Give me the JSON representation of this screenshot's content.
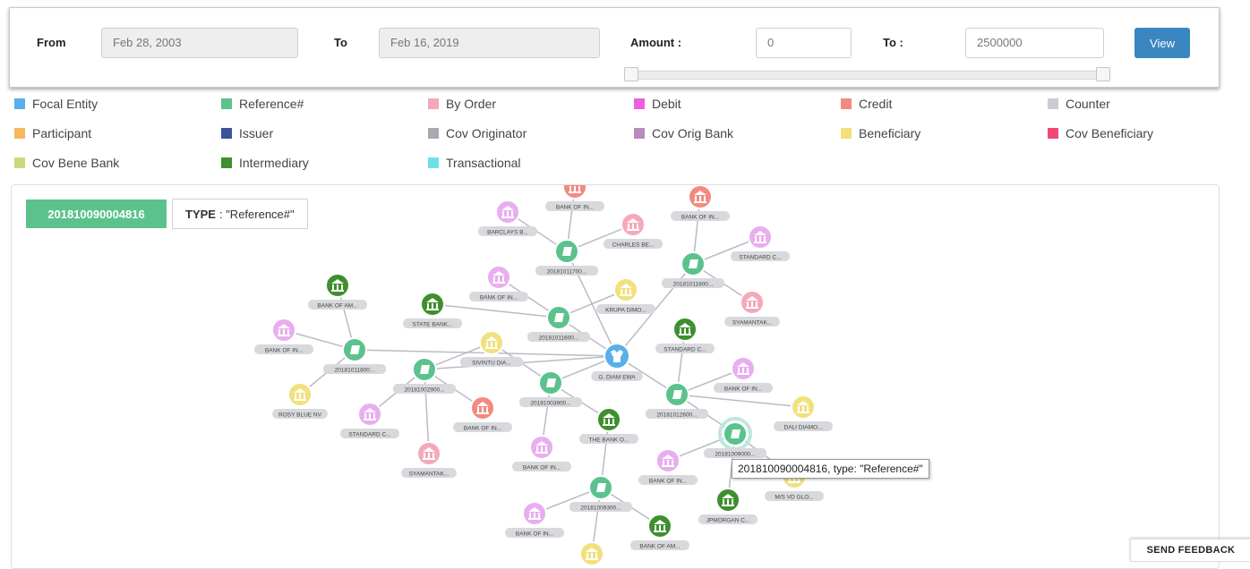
{
  "filters": {
    "from_label": "From",
    "from_value": "Feb 28, 2003",
    "to_label": "To",
    "to_value": "Feb 16, 2019",
    "amount_label": "Amount :",
    "amount_min": "0",
    "amount_to_label": "To :",
    "amount_max": "2500000",
    "view_label": "View",
    "slider_range": [
      0,
      1
    ]
  },
  "legend": [
    {
      "label": "Focal Entity",
      "color": "#5aafea"
    },
    {
      "label": "Reference#",
      "color": "#5cc28d"
    },
    {
      "label": "By Order",
      "color": "#f4a9bb"
    },
    {
      "label": "Debit",
      "color": "#ee5ee0"
    },
    {
      "label": "Credit",
      "color": "#f38a80"
    },
    {
      "label": "Counter",
      "color": "#c9ccd3"
    },
    {
      "label": "Participant",
      "color": "#f4b95c"
    },
    {
      "label": "Issuer",
      "color": "#3a5399"
    },
    {
      "label": "Cov Originator",
      "color": "#a7aab0"
    },
    {
      "label": "Cov Orig Bank",
      "color": "#b98bbf"
    },
    {
      "label": "Beneficiary",
      "color": "#f2e07c"
    },
    {
      "label": "Cov Beneficiary",
      "color": "#ee4a74"
    },
    {
      "label": "Cov Bene Bank",
      "color": "#c8da7a"
    },
    {
      "label": "Intermediary",
      "color": "#3e8f2e"
    },
    {
      "label": "Transactional",
      "color": "#6ee0e8"
    }
  ],
  "selected": {
    "id": "201810090004816",
    "type_label": "TYPE",
    "type_value": ": \"Reference#\""
  },
  "tooltip": "201810090004816, type: \"Reference#\"",
  "feedback_label": "SEND FEEDBACK",
  "graph": {
    "node_colors": {
      "ref": "#5cc28d",
      "bank_pink": "#e8aef0",
      "bank_green": "#3e8f2e",
      "bank_red": "#f38a80",
      "bank_rose": "#f4a9bb",
      "bene": "#f2e07c",
      "focal": "#5aafea"
    },
    "nodes": [
      {
        "id": "focal",
        "kind": "focal",
        "label": "G. DIAM EWA"
      },
      {
        "id": "r1",
        "kind": "ref",
        "label": "20181011700..."
      },
      {
        "id": "r2",
        "kind": "ref",
        "label": "20181011800..."
      },
      {
        "id": "r3",
        "kind": "ref",
        "label": "20181011600..."
      },
      {
        "id": "r4",
        "kind": "ref",
        "label": "20181011800..."
      },
      {
        "id": "r5",
        "kind": "ref",
        "label": "20181002900..."
      },
      {
        "id": "r6",
        "kind": "ref",
        "label": "20181003900..."
      },
      {
        "id": "r7",
        "kind": "ref",
        "label": "20181012600..."
      },
      {
        "id": "r8",
        "kind": "ref",
        "label": "20181009000..."
      },
      {
        "id": "r9",
        "kind": "ref",
        "label": "20181009300..."
      },
      {
        "id": "b1",
        "kind": "bank_red",
        "label": "BANK OF IN..."
      },
      {
        "id": "b2",
        "kind": "bank_pink",
        "label": "BARCLAYS B..."
      },
      {
        "id": "b3",
        "kind": "bank_rose",
        "label": "CHARLES BE..."
      },
      {
        "id": "b4",
        "kind": "bank_red",
        "label": "BANK OF IN..."
      },
      {
        "id": "b5",
        "kind": "bank_pink",
        "label": "STANDARD C..."
      },
      {
        "id": "b6",
        "kind": "bank_rose",
        "label": "SYAMANTAK..."
      },
      {
        "id": "b7",
        "kind": "bank_pink",
        "label": "BANK OF IN..."
      },
      {
        "id": "b8",
        "kind": "bene",
        "label": "KRUPA DIMO..."
      },
      {
        "id": "b9",
        "kind": "bank_green",
        "label": "STATE BANK..."
      },
      {
        "id": "b10",
        "kind": "bank_green",
        "label": "BANK OF AM..."
      },
      {
        "id": "b11",
        "kind": "bank_pink",
        "label": "BANK OF IN..."
      },
      {
        "id": "b12",
        "kind": "bene",
        "label": "ROSY BLUE NV"
      },
      {
        "id": "b13",
        "kind": "bene",
        "label": "SIVINTU DIA..."
      },
      {
        "id": "b14",
        "kind": "bank_pink",
        "label": "STANDARD C..."
      },
      {
        "id": "b15",
        "kind": "bank_rose",
        "label": "SYAMANTAK..."
      },
      {
        "id": "b16",
        "kind": "bank_red",
        "label": "BANK OF IN..."
      },
      {
        "id": "b17",
        "kind": "bank_green",
        "label": "STANDARD C..."
      },
      {
        "id": "b18",
        "kind": "bank_pink",
        "label": "BANK OF IN..."
      },
      {
        "id": "b19",
        "kind": "bene",
        "label": "DALI DIAMO..."
      },
      {
        "id": "b20",
        "kind": "bank_green",
        "label": "THE BANK O..."
      },
      {
        "id": "b21",
        "kind": "bank_pink",
        "label": "BANK OF IN..."
      },
      {
        "id": "b22",
        "kind": "bank_pink",
        "label": "BANK OF IN..."
      },
      {
        "id": "b23",
        "kind": "bene",
        "label": "M/S VD GLO..."
      },
      {
        "id": "b24",
        "kind": "bank_green",
        "label": "JPMORGAN C..."
      },
      {
        "id": "b25",
        "kind": "bank_pink",
        "label": "BANK OF IN..."
      },
      {
        "id": "b26",
        "kind": "bank_green",
        "label": "BANK OF AM..."
      },
      {
        "id": "b27",
        "kind": "bene",
        "label": ""
      }
    ],
    "edges": [
      [
        "focal",
        "r1"
      ],
      [
        "focal",
        "r2"
      ],
      [
        "focal",
        "r3"
      ],
      [
        "focal",
        "r4"
      ],
      [
        "focal",
        "r6"
      ],
      [
        "focal",
        "r7"
      ],
      [
        "focal",
        "r5"
      ],
      [
        "r1",
        "b1"
      ],
      [
        "r1",
        "b2"
      ],
      [
        "r1",
        "b3"
      ],
      [
        "r2",
        "b4"
      ],
      [
        "r2",
        "b5"
      ],
      [
        "r2",
        "b6"
      ],
      [
        "r3",
        "b7"
      ],
      [
        "r3",
        "b8"
      ],
      [
        "r3",
        "b9"
      ],
      [
        "r4",
        "b10"
      ],
      [
        "r4",
        "b11"
      ],
      [
        "r4",
        "b12"
      ],
      [
        "r5",
        "b13"
      ],
      [
        "r5",
        "b14"
      ],
      [
        "r5",
        "b15"
      ],
      [
        "r5",
        "b16"
      ],
      [
        "r6",
        "b13"
      ],
      [
        "r6",
        "b20"
      ],
      [
        "r6",
        "b21"
      ],
      [
        "r7",
        "b17"
      ],
      [
        "r7",
        "b18"
      ],
      [
        "r7",
        "b19"
      ],
      [
        "r7",
        "r8"
      ],
      [
        "r8",
        "b22"
      ],
      [
        "r8",
        "b23"
      ],
      [
        "r8",
        "b24"
      ],
      [
        "b20",
        "r9"
      ],
      [
        "r9",
        "b25"
      ],
      [
        "r9",
        "b26"
      ],
      [
        "r9",
        "b27"
      ]
    ]
  }
}
